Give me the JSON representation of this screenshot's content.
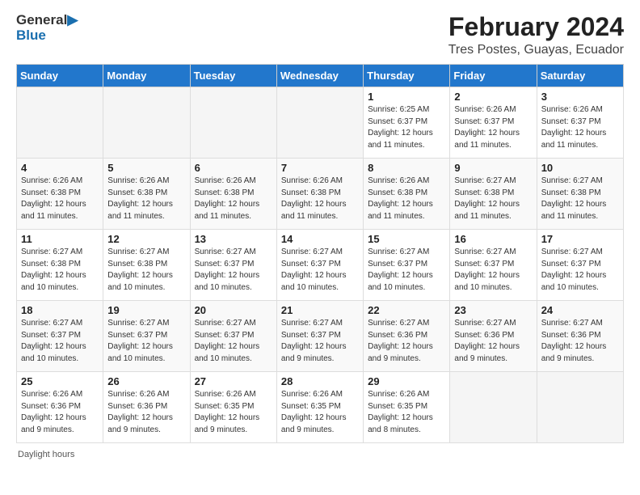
{
  "logo": {
    "text_general": "General",
    "text_blue": "Blue"
  },
  "header": {
    "month_year": "February 2024",
    "location": "Tres Postes, Guayas, Ecuador"
  },
  "days_of_week": [
    "Sunday",
    "Monday",
    "Tuesday",
    "Wednesday",
    "Thursday",
    "Friday",
    "Saturday"
  ],
  "weeks": [
    [
      {
        "day": "",
        "info": ""
      },
      {
        "day": "",
        "info": ""
      },
      {
        "day": "",
        "info": ""
      },
      {
        "day": "",
        "info": ""
      },
      {
        "day": "1",
        "info": "Sunrise: 6:25 AM\nSunset: 6:37 PM\nDaylight: 12 hours and 11 minutes."
      },
      {
        "day": "2",
        "info": "Sunrise: 6:26 AM\nSunset: 6:37 PM\nDaylight: 12 hours and 11 minutes."
      },
      {
        "day": "3",
        "info": "Sunrise: 6:26 AM\nSunset: 6:37 PM\nDaylight: 12 hours and 11 minutes."
      }
    ],
    [
      {
        "day": "4",
        "info": "Sunrise: 6:26 AM\nSunset: 6:38 PM\nDaylight: 12 hours and 11 minutes."
      },
      {
        "day": "5",
        "info": "Sunrise: 6:26 AM\nSunset: 6:38 PM\nDaylight: 12 hours and 11 minutes."
      },
      {
        "day": "6",
        "info": "Sunrise: 6:26 AM\nSunset: 6:38 PM\nDaylight: 12 hours and 11 minutes."
      },
      {
        "day": "7",
        "info": "Sunrise: 6:26 AM\nSunset: 6:38 PM\nDaylight: 12 hours and 11 minutes."
      },
      {
        "day": "8",
        "info": "Sunrise: 6:26 AM\nSunset: 6:38 PM\nDaylight: 12 hours and 11 minutes."
      },
      {
        "day": "9",
        "info": "Sunrise: 6:27 AM\nSunset: 6:38 PM\nDaylight: 12 hours and 11 minutes."
      },
      {
        "day": "10",
        "info": "Sunrise: 6:27 AM\nSunset: 6:38 PM\nDaylight: 12 hours and 11 minutes."
      }
    ],
    [
      {
        "day": "11",
        "info": "Sunrise: 6:27 AM\nSunset: 6:38 PM\nDaylight: 12 hours and 10 minutes."
      },
      {
        "day": "12",
        "info": "Sunrise: 6:27 AM\nSunset: 6:38 PM\nDaylight: 12 hours and 10 minutes."
      },
      {
        "day": "13",
        "info": "Sunrise: 6:27 AM\nSunset: 6:37 PM\nDaylight: 12 hours and 10 minutes."
      },
      {
        "day": "14",
        "info": "Sunrise: 6:27 AM\nSunset: 6:37 PM\nDaylight: 12 hours and 10 minutes."
      },
      {
        "day": "15",
        "info": "Sunrise: 6:27 AM\nSunset: 6:37 PM\nDaylight: 12 hours and 10 minutes."
      },
      {
        "day": "16",
        "info": "Sunrise: 6:27 AM\nSunset: 6:37 PM\nDaylight: 12 hours and 10 minutes."
      },
      {
        "day": "17",
        "info": "Sunrise: 6:27 AM\nSunset: 6:37 PM\nDaylight: 12 hours and 10 minutes."
      }
    ],
    [
      {
        "day": "18",
        "info": "Sunrise: 6:27 AM\nSunset: 6:37 PM\nDaylight: 12 hours and 10 minutes."
      },
      {
        "day": "19",
        "info": "Sunrise: 6:27 AM\nSunset: 6:37 PM\nDaylight: 12 hours and 10 minutes."
      },
      {
        "day": "20",
        "info": "Sunrise: 6:27 AM\nSunset: 6:37 PM\nDaylight: 12 hours and 10 minutes."
      },
      {
        "day": "21",
        "info": "Sunrise: 6:27 AM\nSunset: 6:37 PM\nDaylight: 12 hours and 9 minutes."
      },
      {
        "day": "22",
        "info": "Sunrise: 6:27 AM\nSunset: 6:36 PM\nDaylight: 12 hours and 9 minutes."
      },
      {
        "day": "23",
        "info": "Sunrise: 6:27 AM\nSunset: 6:36 PM\nDaylight: 12 hours and 9 minutes."
      },
      {
        "day": "24",
        "info": "Sunrise: 6:27 AM\nSunset: 6:36 PM\nDaylight: 12 hours and 9 minutes."
      }
    ],
    [
      {
        "day": "25",
        "info": "Sunrise: 6:26 AM\nSunset: 6:36 PM\nDaylight: 12 hours and 9 minutes."
      },
      {
        "day": "26",
        "info": "Sunrise: 6:26 AM\nSunset: 6:36 PM\nDaylight: 12 hours and 9 minutes."
      },
      {
        "day": "27",
        "info": "Sunrise: 6:26 AM\nSunset: 6:35 PM\nDaylight: 12 hours and 9 minutes."
      },
      {
        "day": "28",
        "info": "Sunrise: 6:26 AM\nSunset: 6:35 PM\nDaylight: 12 hours and 9 minutes."
      },
      {
        "day": "29",
        "info": "Sunrise: 6:26 AM\nSunset: 6:35 PM\nDaylight: 12 hours and 8 minutes."
      },
      {
        "day": "",
        "info": ""
      },
      {
        "day": "",
        "info": ""
      }
    ]
  ],
  "footer": {
    "daylight_hours_label": "Daylight hours"
  }
}
